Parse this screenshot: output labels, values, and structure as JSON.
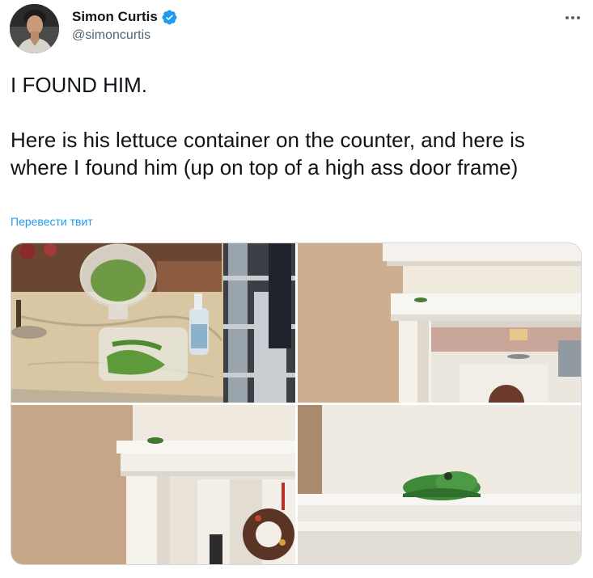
{
  "author": {
    "display_name": "Simon Curtis",
    "handle": "@simoncurtis",
    "verified": true,
    "avatar_icon": "profile-photo"
  },
  "more_icon": "more-horizontal-icon",
  "tweet": {
    "text": "I FOUND HIM.\n\nHere is his lettuce container on the counter, and here is where I found him (up on top of a high ass door frame)",
    "translate_label": "Перевести твит"
  },
  "media": {
    "count": 4
  },
  "colors": {
    "link_blue": "#1d9bf0",
    "verified_blue": "#1d9bf0",
    "secondary_text": "#536471",
    "primary_text": "#0f1419"
  }
}
